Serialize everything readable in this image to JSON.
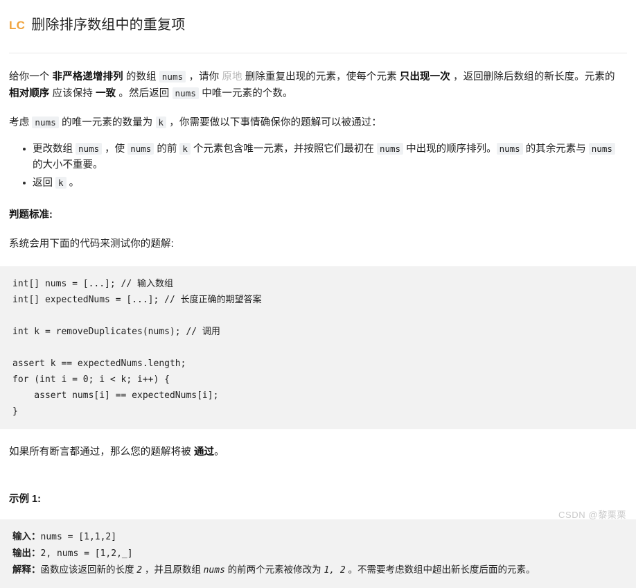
{
  "header": {
    "logo": "LC",
    "title": "删除排序数组中的重复项"
  },
  "intro": {
    "p1_seg1": "给你一个 ",
    "p1_bold1": "非严格递增排列",
    "p1_seg2": " 的数组 ",
    "p1_code1": "nums",
    "p1_seg3": " ，请你 ",
    "p1_muted": "原地",
    "p1_seg4": " 删除重复出现的元素，使每个元素 ",
    "p1_bold2": "只出现一次",
    "p1_seg5": " ，返回删除后数组的新长度。元素的 ",
    "p1_bold3": "相对顺序",
    "p1_seg6": " 应该保持 ",
    "p1_bold4": "一致",
    "p1_seg7": " 。然后返回 ",
    "p1_code2": "nums",
    "p1_seg8": " 中唯一元素的个数。",
    "p2_seg1": "考虑 ",
    "p2_code1": "nums",
    "p2_seg2": " 的唯一元素的数量为 ",
    "p2_code2": "k",
    "p2_seg3": " ，你需要做以下事情确保你的题解可以被通过："
  },
  "bullets": [
    {
      "seg1": "更改数组 ",
      "code1": "nums",
      "seg2": " ，使 ",
      "code2": "nums",
      "seg3": " 的前 ",
      "code3": "k",
      "seg4": " 个元素包含唯一元素，并按照它们最初在 ",
      "code4": "nums",
      "seg5": " 中出现的顺序排列。",
      "code5": "nums",
      "seg6": " 的其余元素与 ",
      "code6": "nums",
      "seg7": " 的大小不重要。"
    },
    {
      "seg1": "返回 ",
      "code1": "k",
      "seg2": " 。"
    }
  ],
  "judge": {
    "heading": "判题标准:",
    "lead": "系统会用下面的代码来测试你的题解:",
    "code": "int[] nums = [...]; // 输入数组\nint[] expectedNums = [...]; // 长度正确的期望答案\n\nint k = removeDuplicates(nums); // 调用\n\nassert k == expectedNums.length;\nfor (int i = 0; i < k; i++) {\n    assert nums[i] == expectedNums[i];\n}",
    "after_seg1": "如果所有断言都通过，那么您的题解将被 ",
    "after_bold": "通过",
    "after_seg2": "。"
  },
  "example": {
    "heading": "示例 1:",
    "input_label": "输入：",
    "input_value": "nums = [1,1,2]",
    "output_label": "输出：",
    "output_value": "2, nums = [1,2,_]",
    "explain_label": "解释：",
    "explain_seg1": "函数应该返回新的长度 ",
    "explain_code1": "2",
    "explain_seg2": " ，并且原数组 ",
    "explain_code2": "nums",
    "explain_seg3": " 的前两个元素被修改为 ",
    "explain_code3": "1, 2",
    "explain_seg4": " 。不需要考虑数组中超出新长度后面的元素。"
  },
  "watermark": "CSDN @黎栗栗",
  "colors": {
    "accent": "#f0a33c",
    "code_bg": "#f2f2f2",
    "chip_bg": "#eff1f3",
    "muted_text": "#b5b5b5",
    "watermark": "#c9c9c9"
  }
}
